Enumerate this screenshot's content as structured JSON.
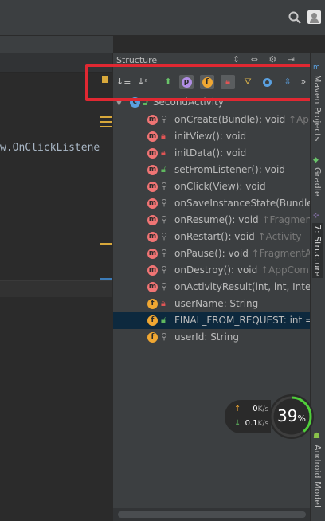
{
  "structure": {
    "title": "Structure",
    "root": {
      "label": "SecondActivity"
    },
    "items": [
      {
        "kind": "m",
        "vis": "pin",
        "label": "onCreate(Bundle): void",
        "suffix": " ↑AppC"
      },
      {
        "kind": "m",
        "vis": "lock-red",
        "label": "initView(): void",
        "suffix": ""
      },
      {
        "kind": "m",
        "vis": "lock-red",
        "label": "initData(): void",
        "suffix": ""
      },
      {
        "kind": "m",
        "vis": "lock-green",
        "label": "setFromListener(): void",
        "suffix": ""
      },
      {
        "kind": "m",
        "vis": "pin",
        "label": "onClick(View): void",
        "suffix": ""
      },
      {
        "kind": "m",
        "vis": "pin",
        "label": "onSaveInstanceState(Bundle):",
        "suffix": ""
      },
      {
        "kind": "m",
        "vis": "pin",
        "label": "onResume(): void",
        "suffix": " ↑FragmentA"
      },
      {
        "kind": "m",
        "vis": "pin",
        "label": "onRestart(): void",
        "suffix": " ↑Activity"
      },
      {
        "kind": "m",
        "vis": "pin",
        "label": "onPause(): void",
        "suffix": " ↑FragmentAc"
      },
      {
        "kind": "m",
        "vis": "pin",
        "label": "onDestroy(): void",
        "suffix": " ↑AppComp"
      },
      {
        "kind": "m",
        "vis": "pin",
        "label": "onActivityResult(int, int, Intent",
        "suffix": ""
      },
      {
        "kind": "f",
        "vis": "lock-red",
        "label": "userName: String",
        "suffix": ""
      },
      {
        "kind": "f",
        "vis": "lock-green",
        "label": "FINAL_FROM_REQUEST: int =",
        "suffix": ""
      },
      {
        "kind": "f",
        "vis": "pin",
        "label": "userId: String",
        "suffix": ""
      }
    ]
  },
  "toolbar": {
    "p_label": "p",
    "f_label": "f",
    "more_label": "»"
  },
  "editor": {
    "code_fragment": "w.OnClickListene"
  },
  "sidebar": {
    "tab_maven": "Maven Projects",
    "tab_gradle": "Gradle",
    "tab_structure": "7: Structure",
    "tab_android_model": "Android Model"
  },
  "speed_widget": {
    "upload_value": "0",
    "upload_unit": "K/s",
    "download_value": "0.1",
    "download_unit": "K/s",
    "percent_value": "39",
    "percent_sign": "%",
    "percent": 39
  },
  "colors": {
    "highlight_border": "#e02832",
    "method_icon": "#f07474",
    "field_icon": "#f0a732",
    "property_icon": "#b28ee6",
    "gauge_arc": "#4fcf3a"
  }
}
